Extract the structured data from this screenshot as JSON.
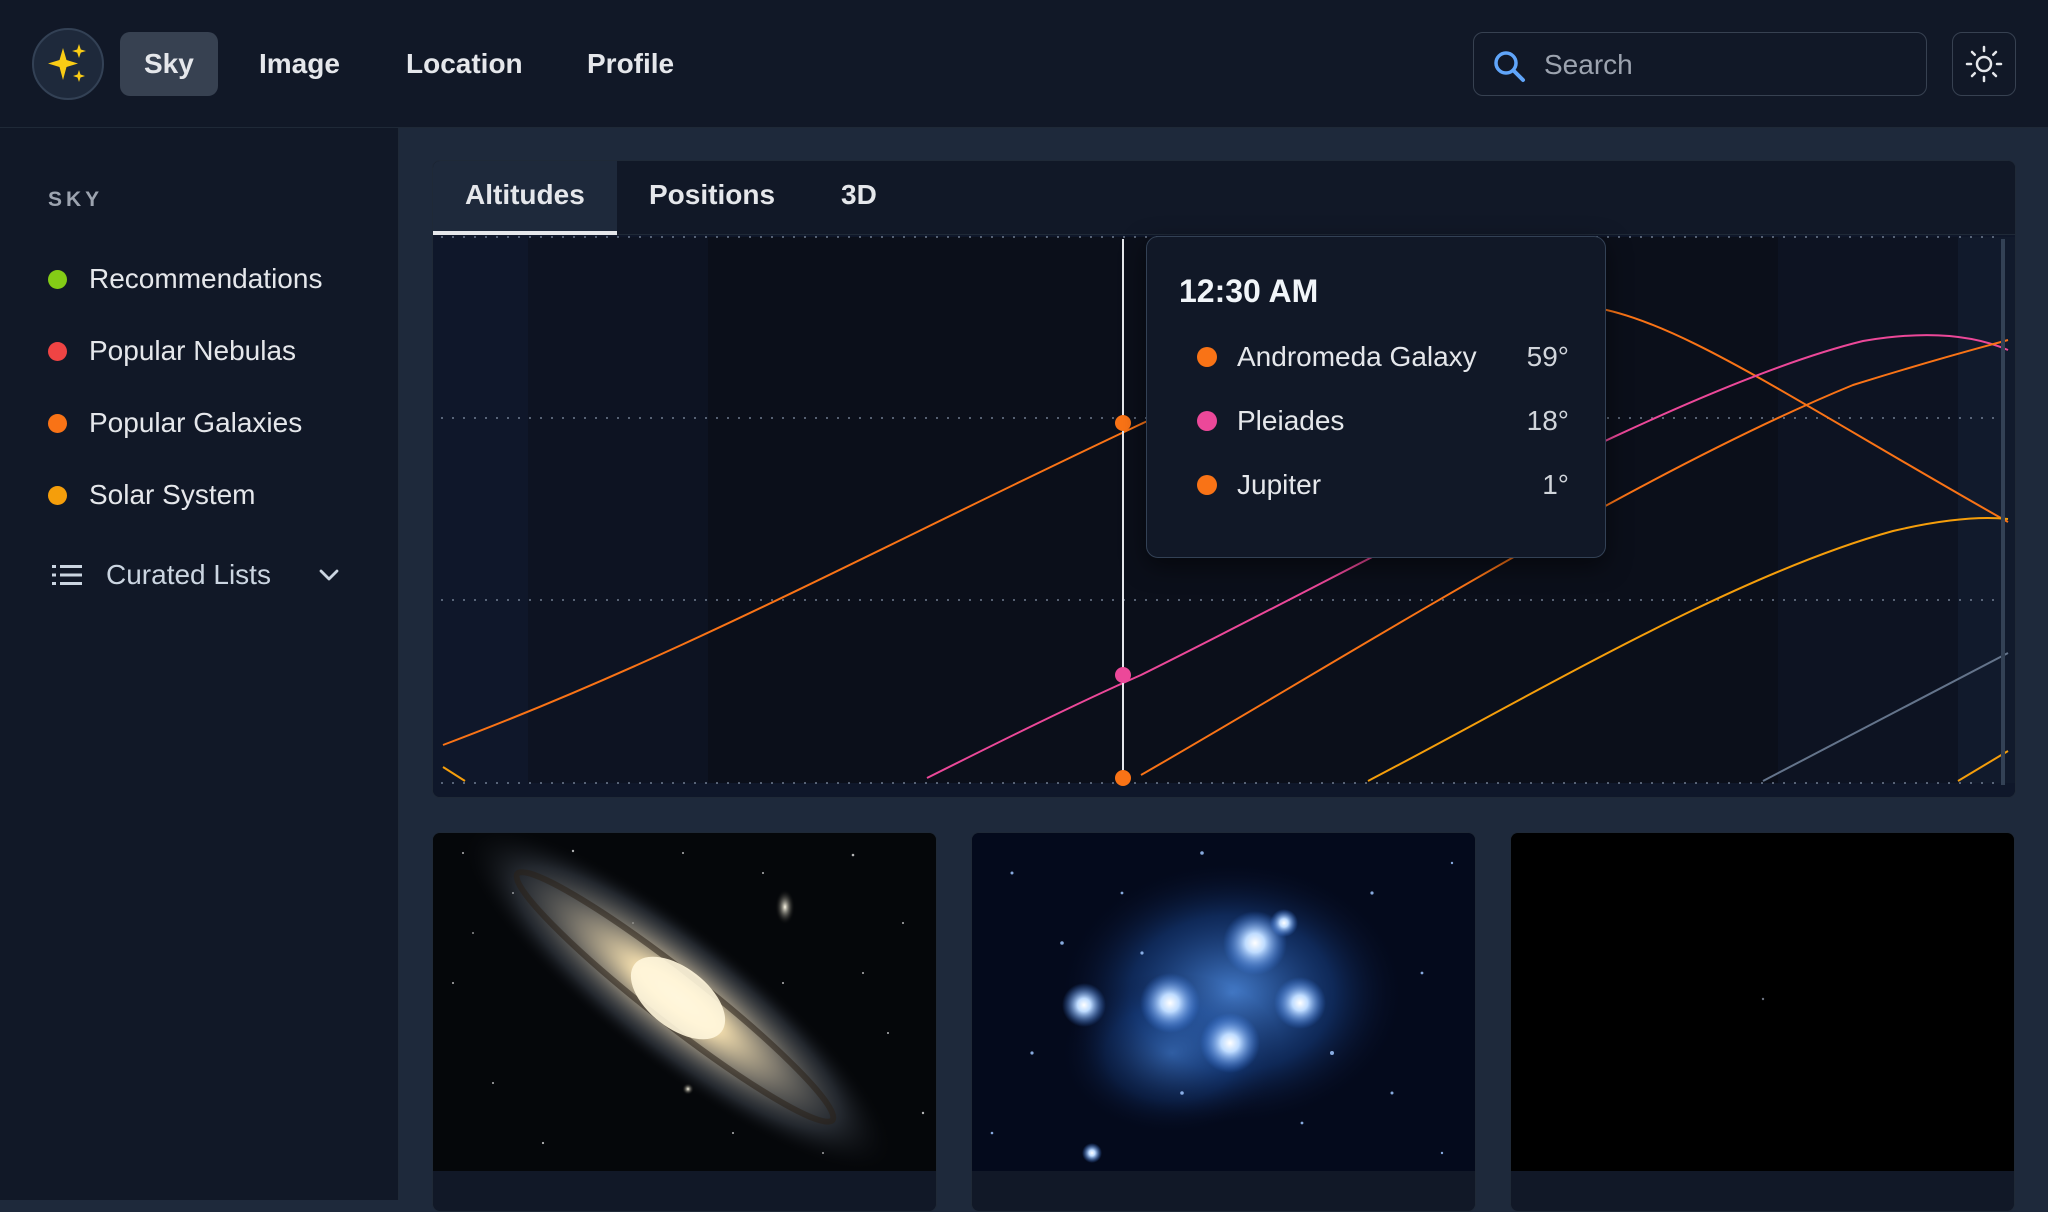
{
  "nav": {
    "items": [
      {
        "label": "Sky",
        "active": true
      },
      {
        "label": "Image",
        "active": false
      },
      {
        "label": "Location",
        "active": false
      },
      {
        "label": "Profile",
        "active": false
      }
    ],
    "search_placeholder": "Search"
  },
  "sidebar": {
    "heading": "SKY",
    "items": [
      {
        "label": "Recommendations",
        "color": "#84cc16"
      },
      {
        "label": "Popular Nebulas",
        "color": "#ef4444"
      },
      {
        "label": "Popular Galaxies",
        "color": "#f97316"
      },
      {
        "label": "Solar System",
        "color": "#f59e0b"
      }
    ],
    "curated_label": "Curated Lists"
  },
  "tabs": [
    {
      "label": "Altitudes",
      "active": true
    },
    {
      "label": "Positions",
      "active": false
    },
    {
      "label": "3D",
      "active": false
    }
  ],
  "tooltip": {
    "time": "12:30 AM",
    "rows": [
      {
        "name": "Andromeda Galaxy",
        "value": "59°",
        "color": "#f97316"
      },
      {
        "name": "Pleiades",
        "value": "18°",
        "color": "#ec4899"
      },
      {
        "name": "Jupiter",
        "value": "1°",
        "color": "#f97316"
      }
    ]
  },
  "cards": [
    {
      "icon": "andromeda-galaxy-image"
    },
    {
      "icon": "pleiades-image"
    },
    {
      "icon": "blank-sky-image"
    }
  ]
}
